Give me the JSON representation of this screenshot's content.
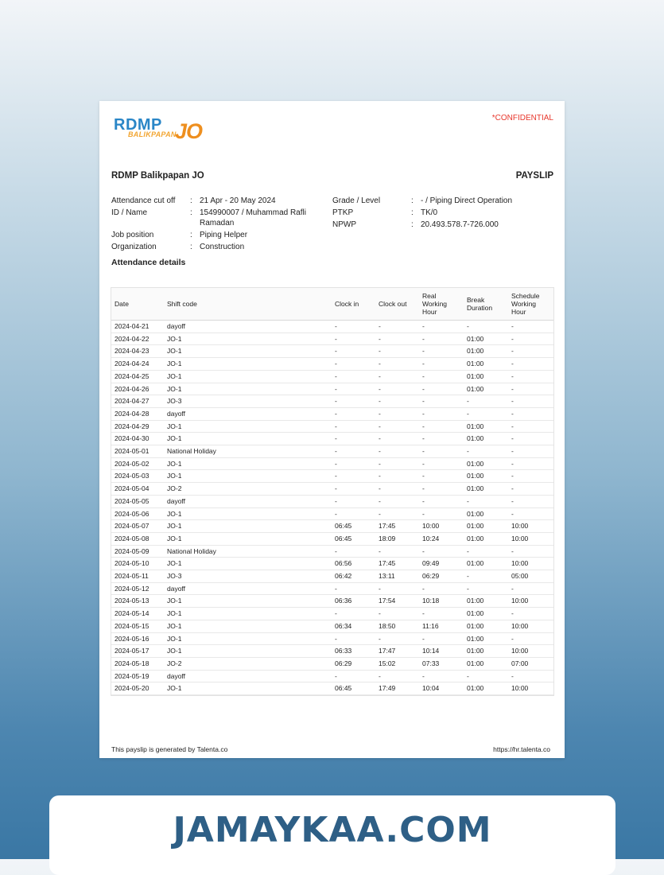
{
  "header": {
    "logo_main": "RDMP",
    "logo_sub": "BALIKPAPAN",
    "logo_jo": "JO",
    "confidential": "*CONFIDENTIAL",
    "company": "RDMP Balikpapan JO",
    "doc_title": "PAYSLIP"
  },
  "info_left": [
    {
      "label": "Attendance cut off",
      "value": "21 Apr - 20 May 2024"
    },
    {
      "label": "ID / Name",
      "value": "154990007 / Muhammad Rafli Ramadan"
    },
    {
      "label": "Job position",
      "value": "Piping Helper"
    },
    {
      "label": "Organization",
      "value": "Construction"
    }
  ],
  "info_right": [
    {
      "label": "Grade / Level",
      "value": "- / Piping Direct Operation"
    },
    {
      "label": "PTKP",
      "value": "TK/0"
    },
    {
      "label": "NPWP",
      "value": "20.493.578.7-726.000"
    }
  ],
  "attendance": {
    "title": "Attendance details",
    "columns": [
      "Date",
      "Shift code",
      "Clock in",
      "Clock out",
      "Real Working Hour",
      "Break Duration",
      "Schedule Working Hour"
    ],
    "rows": [
      [
        "2024-04-21",
        "dayoff",
        "-",
        "-",
        "-",
        "-",
        "-"
      ],
      [
        "2024-04-22",
        "JO-1",
        "-",
        "-",
        "-",
        "01:00",
        "-"
      ],
      [
        "2024-04-23",
        "JO-1",
        "-",
        "-",
        "-",
        "01:00",
        "-"
      ],
      [
        "2024-04-24",
        "JO-1",
        "-",
        "-",
        "-",
        "01:00",
        "-"
      ],
      [
        "2024-04-25",
        "JO-1",
        "-",
        "-",
        "-",
        "01:00",
        "-"
      ],
      [
        "2024-04-26",
        "JO-1",
        "-",
        "-",
        "-",
        "01:00",
        "-"
      ],
      [
        "2024-04-27",
        "JO-3",
        "-",
        "-",
        "-",
        "-",
        "-"
      ],
      [
        "2024-04-28",
        "dayoff",
        "-",
        "-",
        "-",
        "-",
        "-"
      ],
      [
        "2024-04-29",
        "JO-1",
        "-",
        "-",
        "-",
        "01:00",
        "-"
      ],
      [
        "2024-04-30",
        "JO-1",
        "-",
        "-",
        "-",
        "01:00",
        "-"
      ],
      [
        "2024-05-01",
        "National Holiday",
        "-",
        "-",
        "-",
        "-",
        "-"
      ],
      [
        "2024-05-02",
        "JO-1",
        "-",
        "-",
        "-",
        "01:00",
        "-"
      ],
      [
        "2024-05-03",
        "JO-1",
        "-",
        "-",
        "-",
        "01:00",
        "-"
      ],
      [
        "2024-05-04",
        "JO-2",
        "-",
        "-",
        "-",
        "01:00",
        "-"
      ],
      [
        "2024-05-05",
        "dayoff",
        "-",
        "-",
        "-",
        "-",
        "-"
      ],
      [
        "2024-05-06",
        "JO-1",
        "-",
        "-",
        "-",
        "01:00",
        "-"
      ],
      [
        "2024-05-07",
        "JO-1",
        "06:45",
        "17:45",
        "10:00",
        "01:00",
        "10:00"
      ],
      [
        "2024-05-08",
        "JO-1",
        "06:45",
        "18:09",
        "10:24",
        "01:00",
        "10:00"
      ],
      [
        "2024-05-09",
        "National Holiday",
        "-",
        "-",
        "-",
        "-",
        "-"
      ],
      [
        "2024-05-10",
        "JO-1",
        "06:56",
        "17:45",
        "09:49",
        "01:00",
        "10:00"
      ],
      [
        "2024-05-11",
        "JO-3",
        "06:42",
        "13:11",
        "06:29",
        "-",
        "05:00"
      ],
      [
        "2024-05-12",
        "dayoff",
        "-",
        "-",
        "-",
        "-",
        "-"
      ],
      [
        "2024-05-13",
        "JO-1",
        "06:36",
        "17:54",
        "10:18",
        "01:00",
        "10:00"
      ],
      [
        "2024-05-14",
        "JO-1",
        "-",
        "-",
        "-",
        "01:00",
        "-"
      ],
      [
        "2024-05-15",
        "JO-1",
        "06:34",
        "18:50",
        "11:16",
        "01:00",
        "10:00"
      ],
      [
        "2024-05-16",
        "JO-1",
        "-",
        "-",
        "-",
        "01:00",
        "-"
      ],
      [
        "2024-05-17",
        "JO-1",
        "06:33",
        "17:47",
        "10:14",
        "01:00",
        "10:00"
      ],
      [
        "2024-05-18",
        "JO-2",
        "06:29",
        "15:02",
        "07:33",
        "01:00",
        "07:00"
      ],
      [
        "2024-05-19",
        "dayoff",
        "-",
        "-",
        "-",
        "-",
        "-"
      ],
      [
        "2024-05-20",
        "JO-1",
        "06:45",
        "17:49",
        "10:04",
        "01:00",
        "10:00"
      ]
    ]
  },
  "footer": {
    "generated": "This payslip is generated by Talenta.co",
    "url": "https://hr.talenta.co"
  },
  "watermark": "JAMAYKAA.COM"
}
